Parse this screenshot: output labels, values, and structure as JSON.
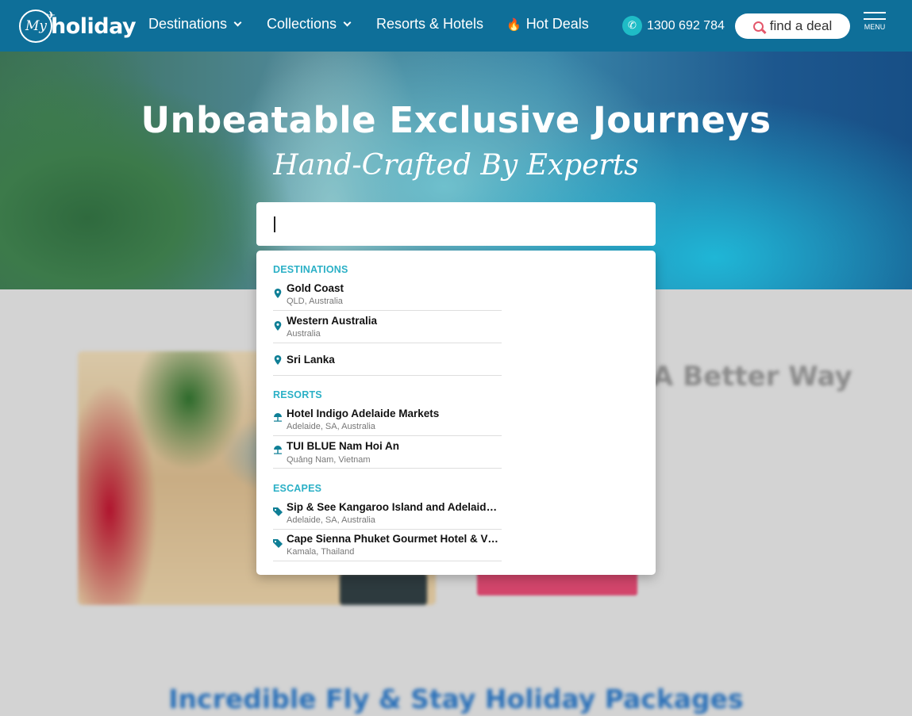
{
  "nav": {
    "logo_my": "My",
    "logo_text": "holiday",
    "items": [
      {
        "label": "Destinations",
        "dropdown": true
      },
      {
        "label": "Collections",
        "dropdown": true
      },
      {
        "label": "Resorts & Hotels",
        "dropdown": false
      },
      {
        "label": "Hot Deals",
        "dropdown": false,
        "icon": "flame-icon"
      }
    ],
    "phone": "1300 692 784",
    "find_deal": "find a deal",
    "menu_label": "MENU"
  },
  "hero": {
    "title": "Unbeatable Exclusive Journeys",
    "subtitle": "Hand-Crafted By Experts"
  },
  "search": {
    "value": "",
    "sections": [
      {
        "label": "DESTINATIONS",
        "icon": "map-pin-icon",
        "items": [
          {
            "title": "Gold Coast",
            "subtitle": "QLD, Australia"
          },
          {
            "title": "Western Australia",
            "subtitle": "Australia"
          },
          {
            "title": "Sri Lanka",
            "subtitle": ""
          }
        ]
      },
      {
        "label": "RESORTS",
        "icon": "beach-umbrella-icon",
        "items": [
          {
            "title": "Hotel Indigo Adelaide Markets",
            "subtitle": "Adelaide, SA, Australia"
          },
          {
            "title": "TUI BLUE Nam Hoi An",
            "subtitle": "Quảng Nam, Vietnam"
          }
        ]
      },
      {
        "label": "ESCAPES",
        "icon": "tag-icon",
        "items": [
          {
            "title": "Sip & See Kangaroo Island and Adelaide...",
            "subtitle": "Adelaide, SA, Australia"
          },
          {
            "title": "Cape Sienna Phuket Gourmet Hotel & Vil...",
            "subtitle": "Kamala, Thailand"
          }
        ]
      }
    ]
  },
  "background": {
    "heading": "A Better Way",
    "bottom_heading": "Incredible Fly & Stay Holiday Packages"
  },
  "colors": {
    "nav_bg": "#0e6f99",
    "accent_teal": "#2bb0c6",
    "pin": "#0f7f96",
    "find_icon": "#e4576b"
  }
}
